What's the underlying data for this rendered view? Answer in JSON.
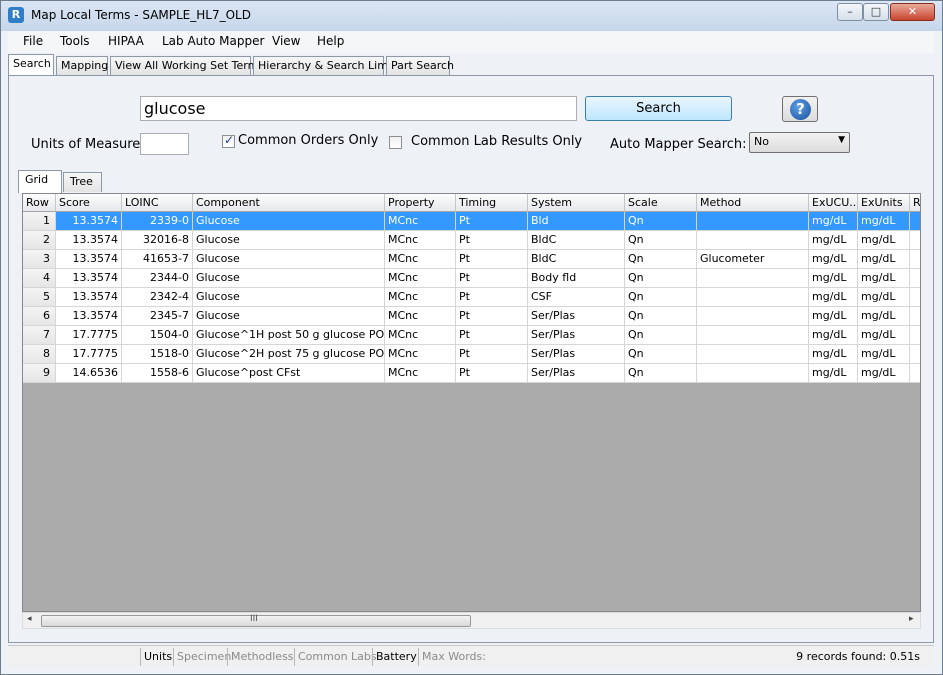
{
  "window": {
    "title": "Map Local Terms - SAMPLE_HL7_OLD",
    "app_icon": "R",
    "controls": {
      "minimize": "–",
      "maximize": "□",
      "close": "✕"
    }
  },
  "menu": [
    "File",
    "Tools",
    "HIPAA",
    "Lab Auto Mapper",
    "View",
    "Help"
  ],
  "tabs": [
    "Search",
    "Mapping",
    "View All Working Set Terms",
    "Hierarchy & Search Limits",
    "Part Search"
  ],
  "active_tab": "Search",
  "search": {
    "value": "glucose",
    "button_label": "Search",
    "help_label": "?"
  },
  "filters": {
    "units_label": "Units of Measure:",
    "units_value": "",
    "common_orders_label": "Common Orders Only",
    "common_orders_checked": true,
    "common_lab_label": "Common Lab Results Only",
    "common_lab_checked": false,
    "auto_mapper_label": "Auto Mapper Search:",
    "auto_mapper_value": "No",
    "auto_mapper_arrow": "▼"
  },
  "subtabs": [
    "Grid",
    "Tree"
  ],
  "grid": {
    "columns": [
      "Row",
      "Score",
      "LOINC",
      "Component",
      "Property",
      "Timing",
      "System",
      "Scale",
      "Method",
      "ExUCU...",
      "ExUnits",
      "Ra"
    ],
    "rows": [
      [
        "1",
        "13.3574",
        "2339-0",
        "Glucose",
        "MCnc",
        "Pt",
        "Bld",
        "Qn",
        "",
        "mg/dL",
        "mg/dL"
      ],
      [
        "2",
        "13.3574",
        "32016-8",
        "Glucose",
        "MCnc",
        "Pt",
        "BldC",
        "Qn",
        "",
        "mg/dL",
        "mg/dL"
      ],
      [
        "3",
        "13.3574",
        "41653-7",
        "Glucose",
        "MCnc",
        "Pt",
        "BldC",
        "Qn",
        "Glucometer",
        "mg/dL",
        "mg/dL"
      ],
      [
        "4",
        "13.3574",
        "2344-0",
        "Glucose",
        "MCnc",
        "Pt",
        "Body fld",
        "Qn",
        "",
        "mg/dL",
        "mg/dL"
      ],
      [
        "5",
        "13.3574",
        "2342-4",
        "Glucose",
        "MCnc",
        "Pt",
        "CSF",
        "Qn",
        "",
        "mg/dL",
        "mg/dL"
      ],
      [
        "6",
        "13.3574",
        "2345-7",
        "Glucose",
        "MCnc",
        "Pt",
        "Ser/Plas",
        "Qn",
        "",
        "mg/dL",
        "mg/dL"
      ],
      [
        "7",
        "17.7775",
        "1504-0",
        "Glucose^1H post 50 g glucose PO",
        "MCnc",
        "Pt",
        "Ser/Plas",
        "Qn",
        "",
        "mg/dL",
        "mg/dL"
      ],
      [
        "8",
        "17.7775",
        "1518-0",
        "Glucose^2H post 75 g glucose PO",
        "MCnc",
        "Pt",
        "Ser/Plas",
        "Qn",
        "",
        "mg/dL",
        "mg/dL"
      ],
      [
        "9",
        "14.6536",
        "1558-6",
        "Glucose^post CFst",
        "MCnc",
        "Pt",
        "Ser/Plas",
        "Qn",
        "",
        "mg/dL",
        "mg/dL"
      ]
    ],
    "selected_row": 1
  },
  "scrollbar": {
    "left_arrow": "◂",
    "right_arrow": "▸",
    "grip": "III"
  },
  "status": {
    "cells": [
      {
        "label": "Units",
        "enabled": true
      },
      {
        "label": "Specimen",
        "enabled": false
      },
      {
        "label": "Methodless",
        "enabled": false
      },
      {
        "label": "Common Labs",
        "enabled": false
      },
      {
        "label": "Battery",
        "enabled": true
      },
      {
        "label": "Max Words:",
        "enabled": false
      }
    ],
    "records_found": "9 records found: 0.51s"
  },
  "colors": {
    "selection": "#3399ff",
    "grid_background": "#ababab",
    "accent": "#2f7ec7"
  }
}
